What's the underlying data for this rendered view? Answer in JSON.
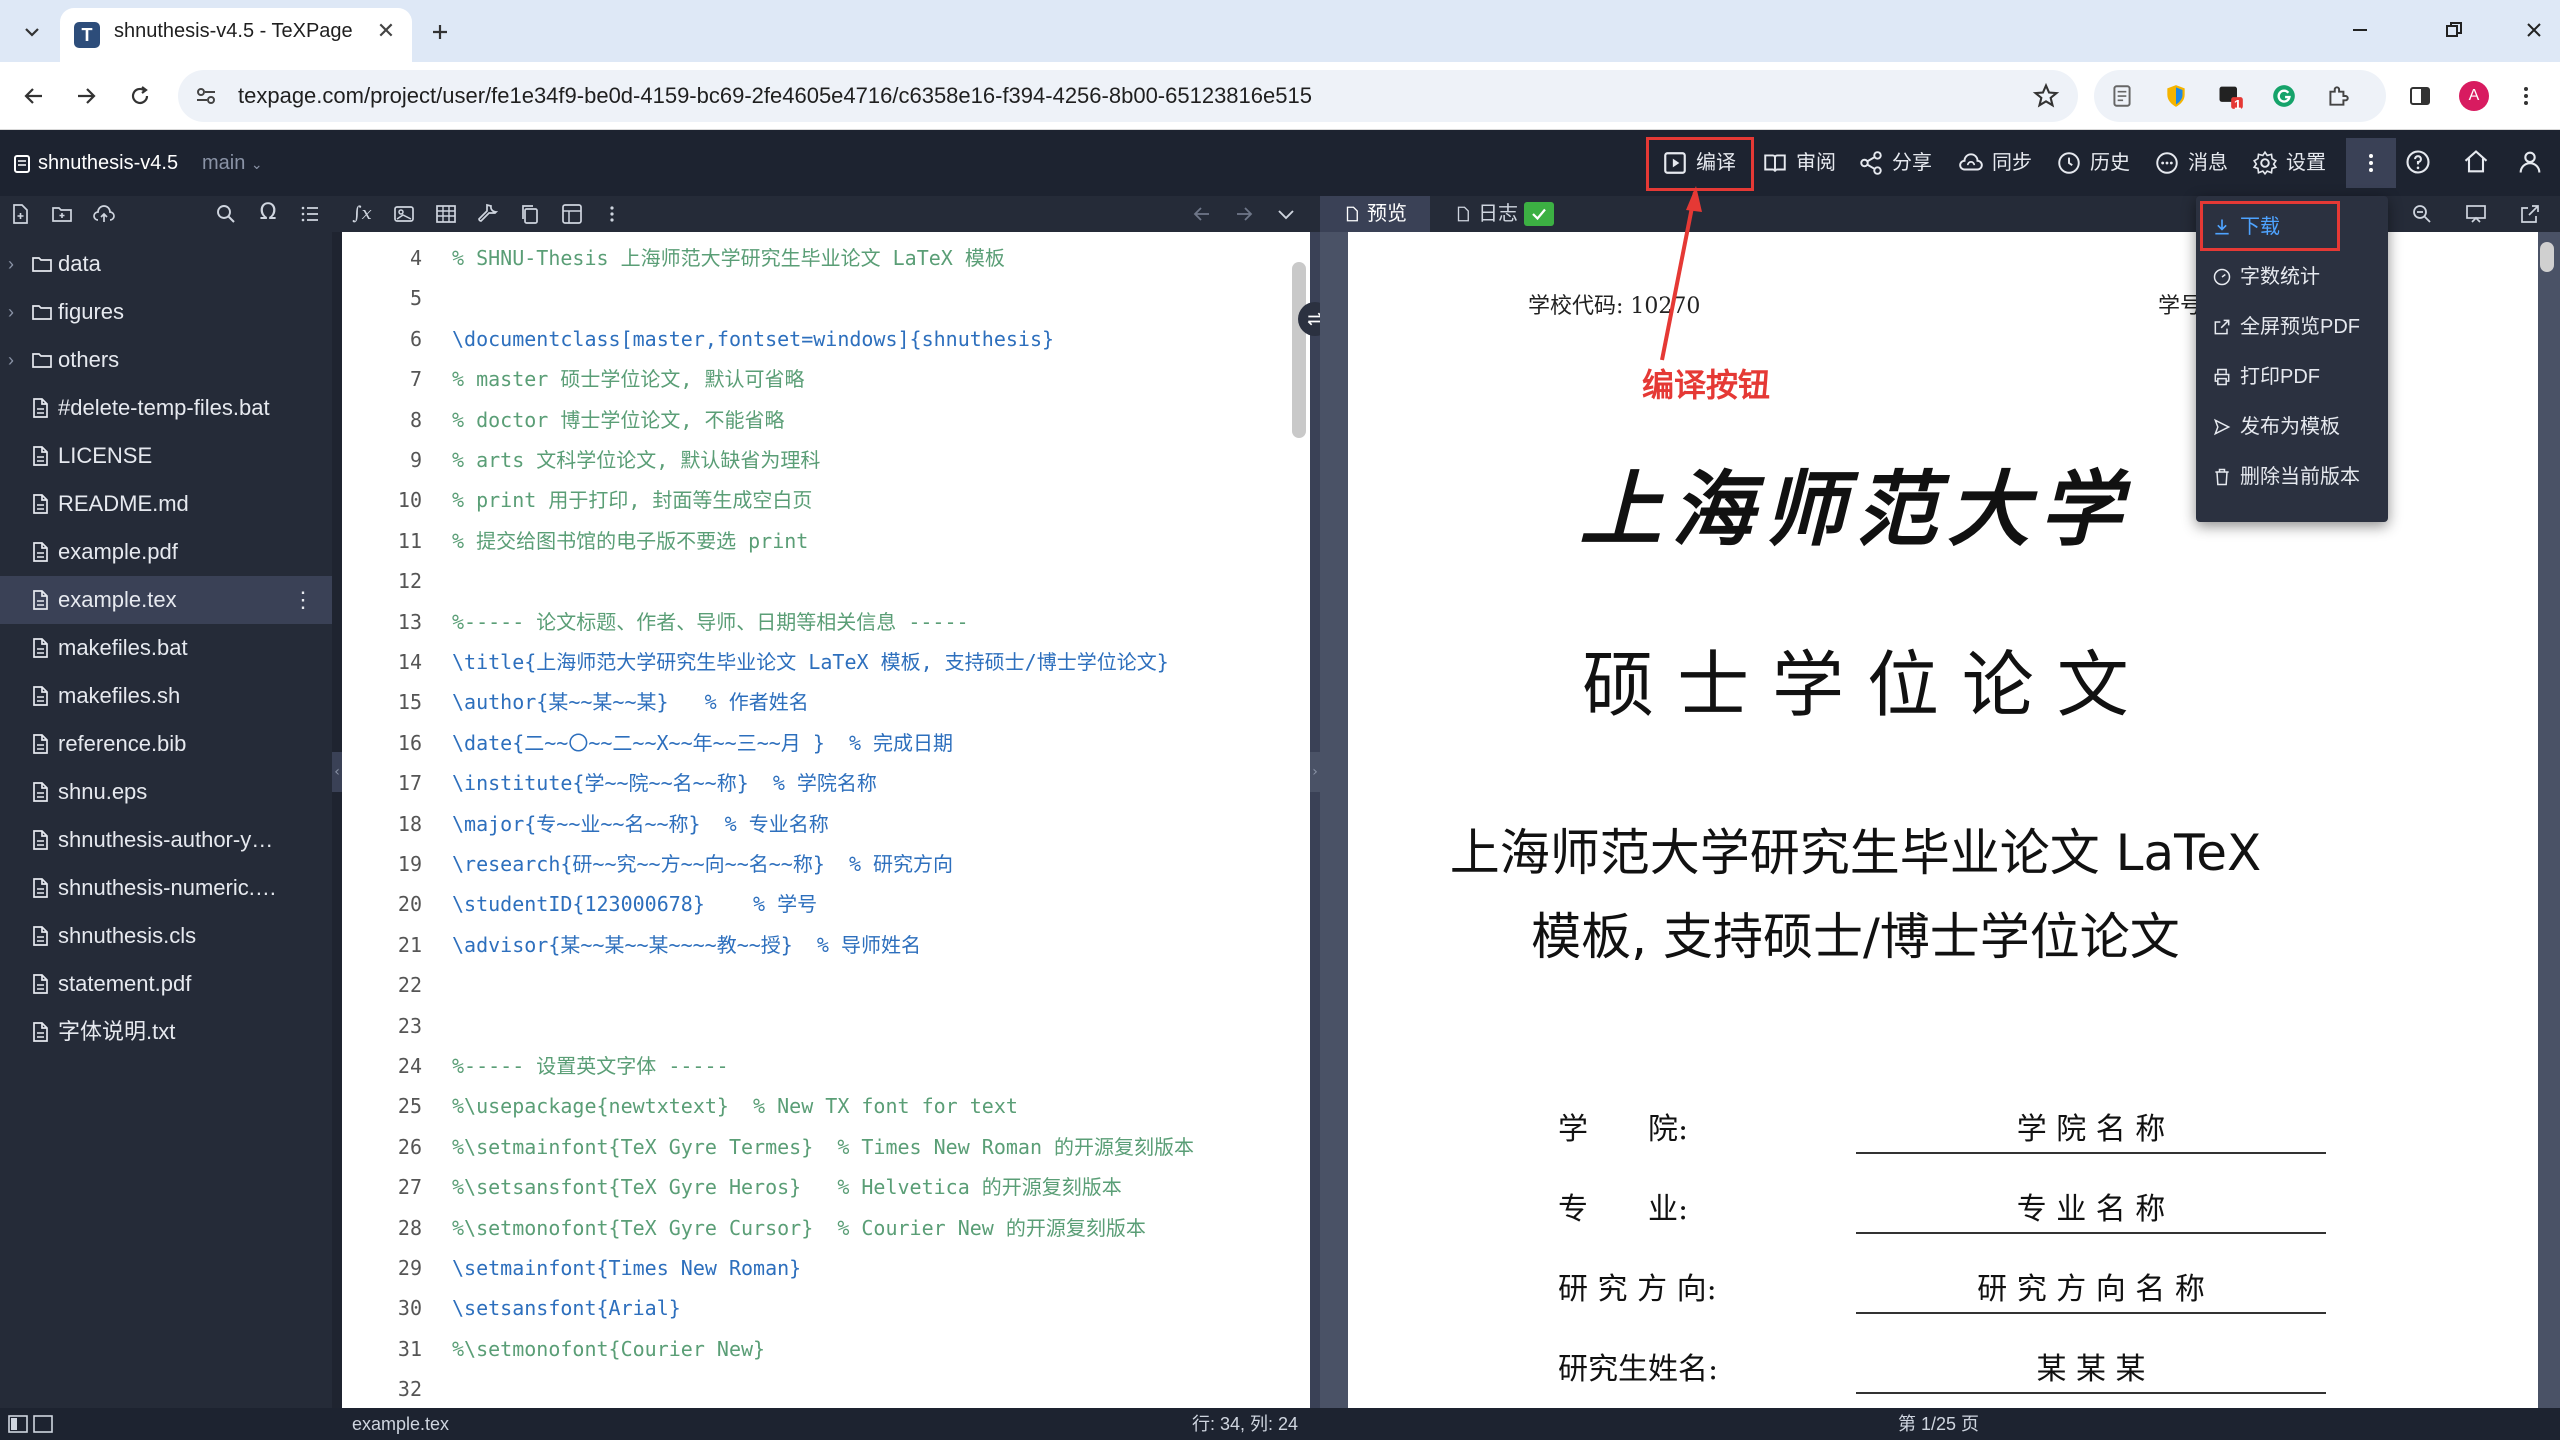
{
  "browser": {
    "tab_title": "shnuthesis-v4.5 - TeXPage",
    "tab_favicon": "T",
    "url": "texpage.com/project/user/fe1e34f9-be0d-4159-bc69-2fe4605e4716/c6358e16-f394-4256-8b00-65123816e515",
    "profile_initial": "A",
    "extension_badge": "1"
  },
  "app": {
    "project_name": "shnuthesis-v4.5",
    "branch": "main",
    "header_buttons": [
      "编译",
      "审阅",
      "分享",
      "同步",
      "历史",
      "消息",
      "设置"
    ]
  },
  "sidebar": {
    "files": [
      {
        "name": "data",
        "type": "folder"
      },
      {
        "name": "figures",
        "type": "folder"
      },
      {
        "name": "others",
        "type": "folder"
      },
      {
        "name": "#delete-temp-files.bat",
        "type": "file"
      },
      {
        "name": "LICENSE",
        "type": "file"
      },
      {
        "name": "README.md",
        "type": "file"
      },
      {
        "name": "example.pdf",
        "type": "file"
      },
      {
        "name": "example.tex",
        "type": "file"
      },
      {
        "name": "makefiles.bat",
        "type": "file"
      },
      {
        "name": "makefiles.sh",
        "type": "file"
      },
      {
        "name": "reference.bib",
        "type": "file"
      },
      {
        "name": "shnu.eps",
        "type": "file"
      },
      {
        "name": "shnuthesis-author-y…",
        "type": "file"
      },
      {
        "name": "shnuthesis-numeric.…",
        "type": "file"
      },
      {
        "name": "shnuthesis.cls",
        "type": "file"
      },
      {
        "name": "statement.pdf",
        "type": "file"
      },
      {
        "name": "字体说明.txt",
        "type": "file"
      }
    ],
    "selected": "example.tex"
  },
  "editor": {
    "lines": [
      {
        "n": "4",
        "t": "% SHNU-Thesis 上海师范大学研究生毕业论文 LaTeX 模板",
        "k": "cm"
      },
      {
        "n": "5",
        "t": "",
        "k": ""
      },
      {
        "n": "6",
        "t": "\\documentclass[master,fontset=windows]{shnuthesis}",
        "k": "cmd"
      },
      {
        "n": "7",
        "t": "% master 硕士学位论文, 默认可省略",
        "k": "cm"
      },
      {
        "n": "8",
        "t": "% doctor 博士学位论文, 不能省略",
        "k": "cm"
      },
      {
        "n": "9",
        "t": "% arts 文科学位论文, 默认缺省为理科",
        "k": "cm"
      },
      {
        "n": "10",
        "t": "% print 用于打印, 封面等生成空白页",
        "k": "cm"
      },
      {
        "n": "11",
        "t": "% 提交给图书馆的电子版不要选 print",
        "k": "cm"
      },
      {
        "n": "12",
        "t": "",
        "k": ""
      },
      {
        "n": "13",
        "t": "%----- 论文标题、作者、导师、日期等相关信息 -----",
        "k": "cm"
      },
      {
        "n": "14",
        "t": "\\title{上海师范大学研究生毕业论文 LaTeX 模板, 支持硕士/博士学位论文}",
        "k": "cmd"
      },
      {
        "n": "15",
        "t": "\\author{某~~某~~某}   % 作者姓名",
        "k": "cmd"
      },
      {
        "n": "16",
        "t": "\\date{二~~〇~~二~~X~~年~~三~~月 }  % 完成日期",
        "k": "cmd"
      },
      {
        "n": "17",
        "t": "\\institute{学~~院~~名~~称}  % 学院名称",
        "k": "cmd"
      },
      {
        "n": "18",
        "t": "\\major{专~~业~~名~~称}  % 专业名称",
        "k": "cmd"
      },
      {
        "n": "19",
        "t": "\\research{研~~究~~方~~向~~名~~称}  % 研究方向",
        "k": "cmd"
      },
      {
        "n": "20",
        "t": "\\studentID{123000678}    % 学号",
        "k": "cmd"
      },
      {
        "n": "21",
        "t": "\\advisor{某~~某~~某~~~~教~~授}  % 导师姓名",
        "k": "cmd"
      },
      {
        "n": "22",
        "t": "",
        "k": ""
      },
      {
        "n": "23",
        "t": "",
        "k": ""
      },
      {
        "n": "24",
        "t": "%----- 设置英文字体 -----",
        "k": "cm"
      },
      {
        "n": "25",
        "t": "%\\usepackage{newtxtext}  % New TX font for text",
        "k": "cm"
      },
      {
        "n": "26",
        "t": "%\\setmainfont{TeX Gyre Termes}  % Times New Roman 的开源复刻版本",
        "k": "cm"
      },
      {
        "n": "27",
        "t": "%\\setsansfont{TeX Gyre Heros}   % Helvetica 的开源复刻版本",
        "k": "cm"
      },
      {
        "n": "28",
        "t": "%\\setmonofont{TeX Gyre Cursor}  % Courier New 的开源复刻版本",
        "k": "cm"
      },
      {
        "n": "29",
        "t": "\\setmainfont{Times New Roman}",
        "k": "cmd"
      },
      {
        "n": "30",
        "t": "\\setsansfont{Arial}",
        "k": "cmd"
      },
      {
        "n": "31",
        "t": "%\\setmonofont{Courier New}",
        "k": "cm"
      },
      {
        "n": "32",
        "t": "",
        "k": ""
      }
    ]
  },
  "preview": {
    "tab_preview": "预览",
    "tab_log": "日志",
    "school_code_label": "学校代码: 10270",
    "student_id_partial": "学号",
    "university": "上海师范大学",
    "degree": "硕 士 学 位 论 文",
    "title_line1": "上海师范大学研究生毕业论文 LaTeX",
    "title_line2": "模板, 支持硕士/博士学位论文",
    "fields": [
      {
        "label": "学　　院:",
        "value": "学 院 名 称"
      },
      {
        "label": "专　　业:",
        "value": "专 业 名 称"
      },
      {
        "label": "研 究 方 向:",
        "value": "研 究 方 向 名 称"
      },
      {
        "label": "研究生姓名:",
        "value": "某 某 某"
      }
    ]
  },
  "annotation": {
    "text": "编译按钮",
    "color": "#e53935"
  },
  "menu": {
    "items": [
      "下载",
      "字数统计",
      "全屏预览PDF",
      "打印PDF",
      "发布为模板",
      "删除当前版本"
    ]
  },
  "status": {
    "filename": "example.tex",
    "cursor": "行: 34, 列: 24",
    "page": "第 1/25 页"
  }
}
